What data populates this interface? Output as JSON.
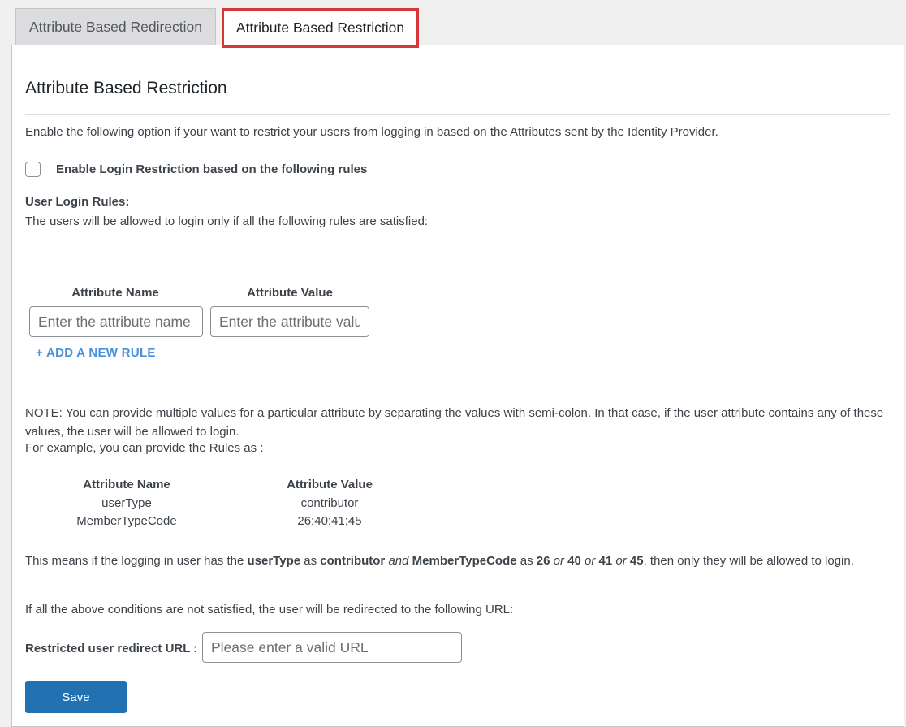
{
  "tabs": [
    {
      "label": "Attribute Based Redirection",
      "active": false
    },
    {
      "label": "Attribute Based Restriction",
      "active": true
    }
  ],
  "section": {
    "title": "Attribute Based Restriction",
    "description": "Enable the following option if your want to restrict your users from logging in based on the Attributes sent by the Identity Provider."
  },
  "restriction": {
    "checkbox_label": "Enable Login Restriction based on the following rules",
    "checked": false
  },
  "rules": {
    "title": "User Login Rules:",
    "description": "The users will be allowed to login only if all the following rules are satisfied:",
    "name_header": "Attribute Name",
    "value_header": "Attribute Value",
    "name_placeholder": "Enter the attribute name",
    "value_placeholder": "Enter the attribute value",
    "add_rule_label": "+ ADD A NEW RULE"
  },
  "note": {
    "prefix": "NOTE:",
    "text": " You can provide multiple values for a particular attribute by separating the values with semi-colon. In that case, if the user attribute contains any of these values, the user will be allowed to login.",
    "example_intro": "For example, you can provide the Rules as :"
  },
  "example_table": {
    "headers": [
      "Attribute Name",
      "Attribute Value"
    ],
    "rows": [
      [
        "userType",
        "contributor"
      ],
      [
        "MemberTypeCode",
        "26;40;41;45"
      ]
    ]
  },
  "explanation": {
    "t1": "This means if the logging in user has the ",
    "b1": "userType",
    "t2": " as ",
    "b2": "contributor",
    "i1": "and",
    "b3": "MemberTypeCode",
    "t3": " as ",
    "b4": "26",
    "i2": "or",
    "b5": "40",
    "i3": "or",
    "b6": "41",
    "i4": "or",
    "b7": "45",
    "t4": ", then only they will be allowed to login."
  },
  "redirect": {
    "condition_text": "If all the above conditions are not satisfied, the user will be redirected to the following URL:",
    "label": "Restricted user redirect URL :",
    "placeholder": "Please enter a valid URL",
    "value": ""
  },
  "save_label": "Save",
  "colors": {
    "accent": "#2271b1",
    "link": "#4a90d9",
    "highlight_border": "#d63638"
  }
}
